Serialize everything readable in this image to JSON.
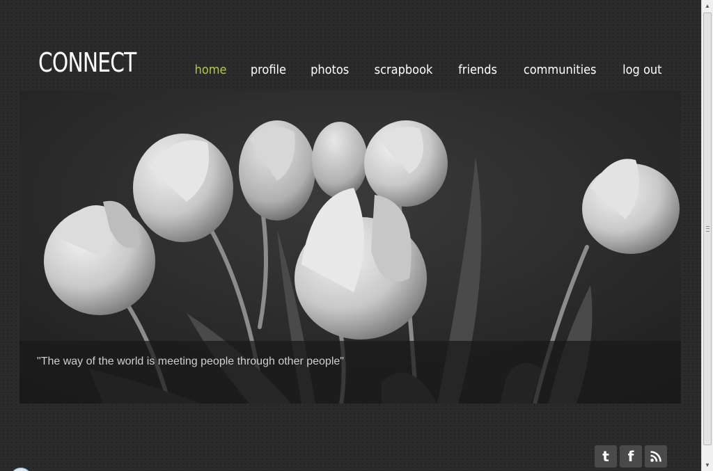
{
  "site": {
    "logo": "CONNECT"
  },
  "nav": {
    "items": [
      {
        "label": "home",
        "active": true
      },
      {
        "label": "profile",
        "active": false
      },
      {
        "label": "photos",
        "active": false
      },
      {
        "label": "scrapbook",
        "active": false
      },
      {
        "label": "friends",
        "active": false
      },
      {
        "label": "communities",
        "active": false
      },
      {
        "label": "log out",
        "active": false
      }
    ],
    "active_color": "#b5c93a"
  },
  "hero": {
    "caption": "\"The way of the world is meeting people through other people\""
  },
  "social": {
    "icons": [
      "twitter-icon",
      "facebook-icon",
      "rss-icon"
    ],
    "glyphs": [
      "t",
      "f",
      ""
    ]
  }
}
